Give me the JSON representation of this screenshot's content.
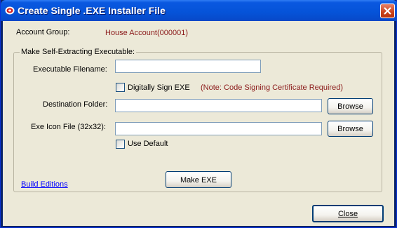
{
  "window": {
    "title": "Create Single .EXE Installer File"
  },
  "account": {
    "label": "Account Group:",
    "value": "House Account(000001)"
  },
  "group": {
    "legend": "Make Self-Extracting Executable:",
    "exe_filename": {
      "label": "Executable Filename:",
      "value": ""
    },
    "sign": {
      "label": "Digitally Sign EXE",
      "checked": false,
      "note": "(Note:  Code Signing Certificate Required)"
    },
    "dest": {
      "label": "Destination Folder:",
      "value": "",
      "browse": "Browse"
    },
    "icon": {
      "label": "Exe Icon File (32x32):",
      "value": "",
      "browse": "Browse"
    },
    "use_default": {
      "label": "Use Default",
      "checked": false
    },
    "make_button": "Make EXE"
  },
  "footer": {
    "link": "Build Editions",
    "close": "Close"
  },
  "colors": {
    "title_bar": "#0553d8",
    "value_text": "#8b1a1a",
    "link": "#0000ff"
  }
}
